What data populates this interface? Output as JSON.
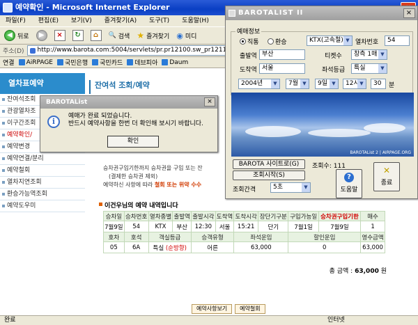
{
  "ie": {
    "title": "예약확인 - Microsoft Internet Explorer",
    "menu": [
      "파일(F)",
      "편집(E)",
      "보기(V)",
      "즐겨찾기(A)",
      "도구(T)",
      "도움말(H)"
    ],
    "toolbar": {
      "back": "뒤로",
      "search": "검색",
      "favorites": "즐겨찾기",
      "media": "미디"
    },
    "address_label": "주소(D)",
    "address": "http://www.barota.com:5004/servlets/pr.pr12100.sw_pr12111_i1S",
    "links_label": "연결",
    "links": [
      "AiRPAGE",
      "국민은행",
      "국민카드",
      "데브피아",
      "Daum"
    ],
    "status_left": "완료",
    "status_right": "인터넷"
  },
  "nav": {
    "header": "열차표예약",
    "items": [
      "잔여석조회",
      "관광열차조",
      "이구간조회",
      "예약확인/",
      "예약변경",
      "예약연결/분리",
      "예약철회",
      "열차지연조회",
      "환승가능역조회",
      "예약도우미"
    ]
  },
  "page": {
    "title": "잔여석 조회/예약",
    "note1": "승차권구입기한까지 승차권을 구입 또는 잔",
    "note1b": "(결제한 승차권 제외)",
    "note2a": "예약하신 사항에 따라 ",
    "note2b": "철회 또는 위약 수수",
    "section_title": "이건우님의 예약 내역입니다",
    "headers1": [
      "승차일",
      "승차번호",
      "열차종별",
      "출발역",
      "출발시각",
      "도착역",
      "도착시각",
      "장단기구분",
      "구입가능일",
      "승차권구입기한",
      "매수"
    ],
    "row1": [
      "7월9일",
      "54",
      "KTX",
      "부산",
      "12:30",
      "서울",
      "15:21",
      "단기",
      "7월1일",
      "7월9일",
      "1"
    ],
    "headers2": [
      "호차",
      "호석",
      "객실등급",
      "승객유형",
      "좌석운임",
      "할인운임",
      "영수금액"
    ],
    "row2": [
      "05",
      "6A",
      "특실",
      "(순방향)",
      "어른",
      "63,000",
      "0",
      "63,000"
    ],
    "total_label": "총 금액 :",
    "total_value": "63,000",
    "total_unit": "원",
    "btn_view": "예약사항보기",
    "btn_cancel": "예약철회"
  },
  "barota": {
    "title": "BAROTALIST II",
    "group": "예매정보",
    "radio_direct": "직통",
    "radio_transfer": "환승",
    "train_type": "KTX(고속철)",
    "train_no_label": "열차번호",
    "train_no": "54",
    "dep_label": "출발역",
    "dep": "부산",
    "count_label": "티켓수",
    "count": "창측 1매",
    "arr_label": "도착역",
    "arr": "서울",
    "class_label": "좌석등급",
    "class": "특실",
    "year": "2004년",
    "month": "7월",
    "day": "9일",
    "hour": "12시",
    "minute": "30",
    "minute_unit": "분",
    "image_caption": "BAROTAList 2 | AIRPAGE.ORG",
    "site_button": "BAROTA 사이트로(G)",
    "count_view_label": "조회수:",
    "count_view": "111",
    "start_button": "조회시작(S)",
    "interval_label": "조회간격",
    "interval": "5초",
    "help": "도움말",
    "exit": "종료"
  },
  "dialog": {
    "title": "BAROTAList",
    "line1": "예매가 완료 되었습니다.",
    "line2": "반드시 예약사항을 한번 더 확인해 보시기 바랍니다.",
    "ok": "확인"
  }
}
